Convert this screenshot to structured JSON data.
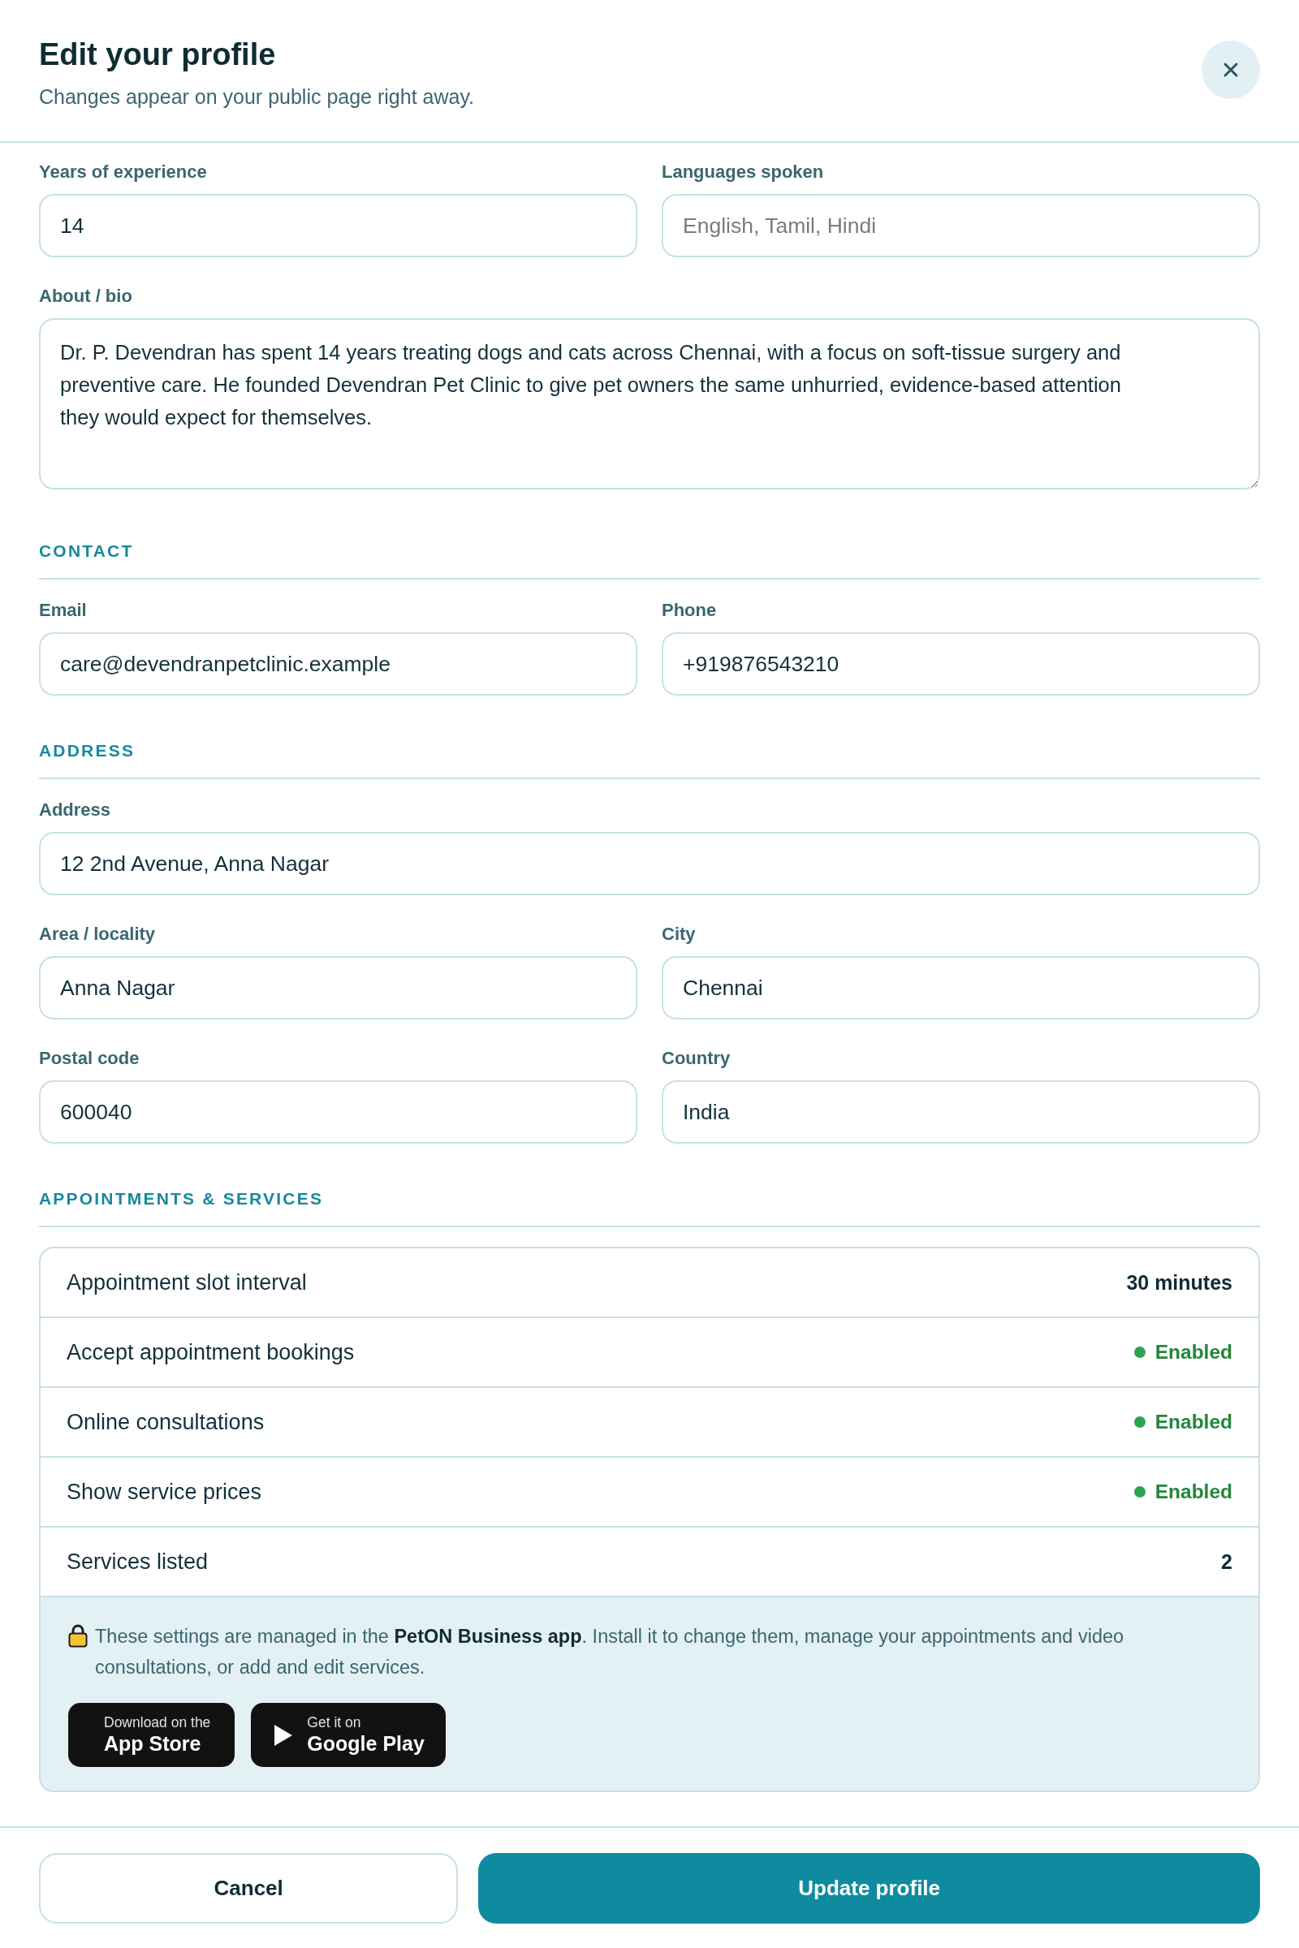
{
  "dialog": {
    "title": "Edit your profile",
    "subtitle": "Changes appear on your public page right away."
  },
  "profile_fields": [
    {
      "kind": "input",
      "label": "Years of experience",
      "value": "14"
    },
    {
      "kind": "input",
      "label": "Languages spoken",
      "placeholder": "English, Tamil, Hindi"
    },
    {
      "kind": "textarea",
      "label": "About / bio",
      "value": "Dr. P. Devendran has spent 14 years treating dogs and cats across Chennai, with a focus on soft-tissue surgery and preventive care. He founded Devendran Pet Clinic to give pet owners the same unhurried, evidence-based attention they would expect for themselves."
    }
  ],
  "sections": [
    {
      "heading": "CONTACT",
      "fields": [
        {
          "kind": "input",
          "label": "Email",
          "value": "care@devendranpetclinic.example"
        },
        {
          "kind": "input",
          "label": "Phone",
          "value": "+919876543210"
        }
      ]
    },
    {
      "heading": "ADDRESS",
      "fields": [
        {
          "kind": "wide_input",
          "label": "Address",
          "value": "12 2nd Avenue, Anna Nagar"
        },
        {
          "kind": "input",
          "label": "Area / locality",
          "value": "Anna Nagar"
        },
        {
          "kind": "input",
          "label": "City",
          "value": "Chennai"
        },
        {
          "kind": "input",
          "label": "Postal code",
          "value": "600040"
        },
        {
          "kind": "input",
          "label": "Country",
          "value": "India"
        }
      ]
    }
  ],
  "appointments": {
    "heading": "APPOINTMENTS & SERVICES",
    "settings": [
      {
        "kind": "value",
        "label": "Appointment slot interval",
        "value": "30 minutes"
      },
      {
        "kind": "status",
        "label": "Accept appointment bookings",
        "value": "Enabled",
        "color": "#2ea44f"
      },
      {
        "kind": "status",
        "label": "Online consultations",
        "value": "Enabled",
        "color": "#2ea44f"
      },
      {
        "kind": "status",
        "label": "Show service prices",
        "value": "Enabled",
        "color": "#2ea44f"
      },
      {
        "kind": "value",
        "label": "Services listed",
        "value": "2"
      }
    ],
    "notice": {
      "text": "These settings are managed in the **PetON Business app**. Install it to change them, manage your appointments and video consultations, or add and edit services.",
      "store_buttons": [
        {
          "kind": "app_store",
          "caption": "Download on the",
          "store": "App Store"
        },
        {
          "kind": "google_play",
          "caption": "Get it on",
          "store": "Google Play"
        }
      ]
    }
  },
  "footer_buttons": [
    {
      "kind": "secondary",
      "label": "Cancel"
    },
    {
      "kind": "primary",
      "label": "Update profile"
    }
  ]
}
